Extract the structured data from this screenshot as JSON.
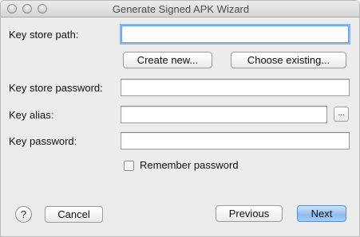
{
  "window": {
    "title": "Generate Signed APK Wizard"
  },
  "form": {
    "key_store_path_label": "Key store path:",
    "key_store_path_value": "",
    "create_new_label": "Create new...",
    "choose_existing_label": "Choose existing...",
    "key_store_password_label": "Key store password:",
    "key_store_password_value": "",
    "key_alias_label": "Key alias:",
    "key_alias_value": "",
    "key_alias_browse_label": "...",
    "key_password_label": "Key password:",
    "key_password_value": "",
    "remember_password_label": "Remember password",
    "remember_password_checked": false
  },
  "footer": {
    "help_label": "?",
    "cancel_label": "Cancel",
    "previous_label": "Previous",
    "next_label": "Next"
  }
}
